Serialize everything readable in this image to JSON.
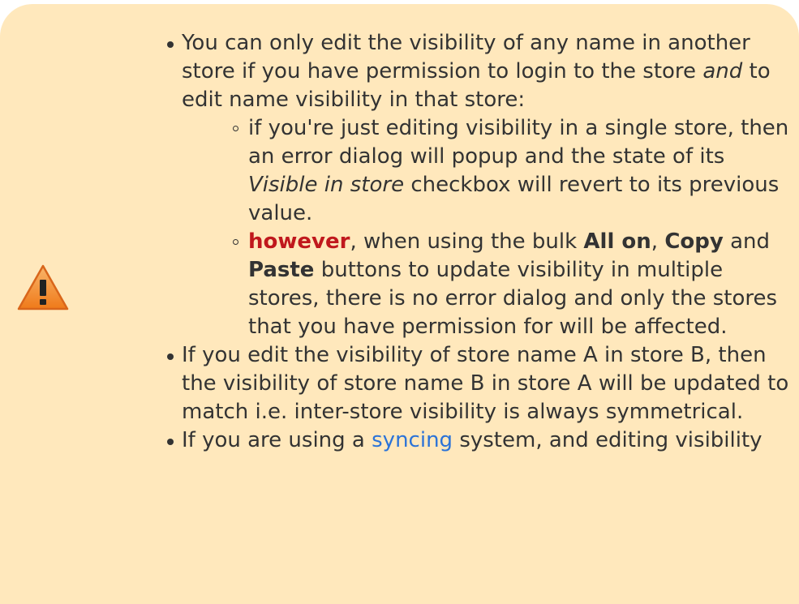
{
  "note": {
    "icon": "warning-icon",
    "items": [
      {
        "p1": "You can only edit the visibility of any name in another store if you have permission to login to the store ",
        "em": "and",
        "p2": " to edit name visibility in that store:",
        "sub": [
          {
            "p1": "if you're just editing visibility in a single store, then an error dialog will popup and the state of its ",
            "em": "Visible in store",
            "p2": " checkbox will revert to its previous value."
          },
          {
            "highlight": "however",
            "p1": ", when using the bulk ",
            "b1": "All on",
            "p2": ", ",
            "b2": "Copy",
            "p3": " and ",
            "b3": "Paste",
            "p4": " buttons to update visibility in multiple stores, there is no error dialog and only the stores that you have permission for will be affected."
          }
        ]
      },
      {
        "text": "If you edit the visibility of store name A in store B, then the visibility of store name B in store A will be updated to match i.e. inter-store visibility is always symmetrical."
      },
      {
        "p1": "If you are using a ",
        "link": "syncing",
        "p2": " system, and editing visibility"
      }
    ]
  },
  "colors": {
    "background": "#ffe8bc",
    "text": "#333333",
    "highlight": "#c0181d",
    "link": "#2b73d8"
  }
}
